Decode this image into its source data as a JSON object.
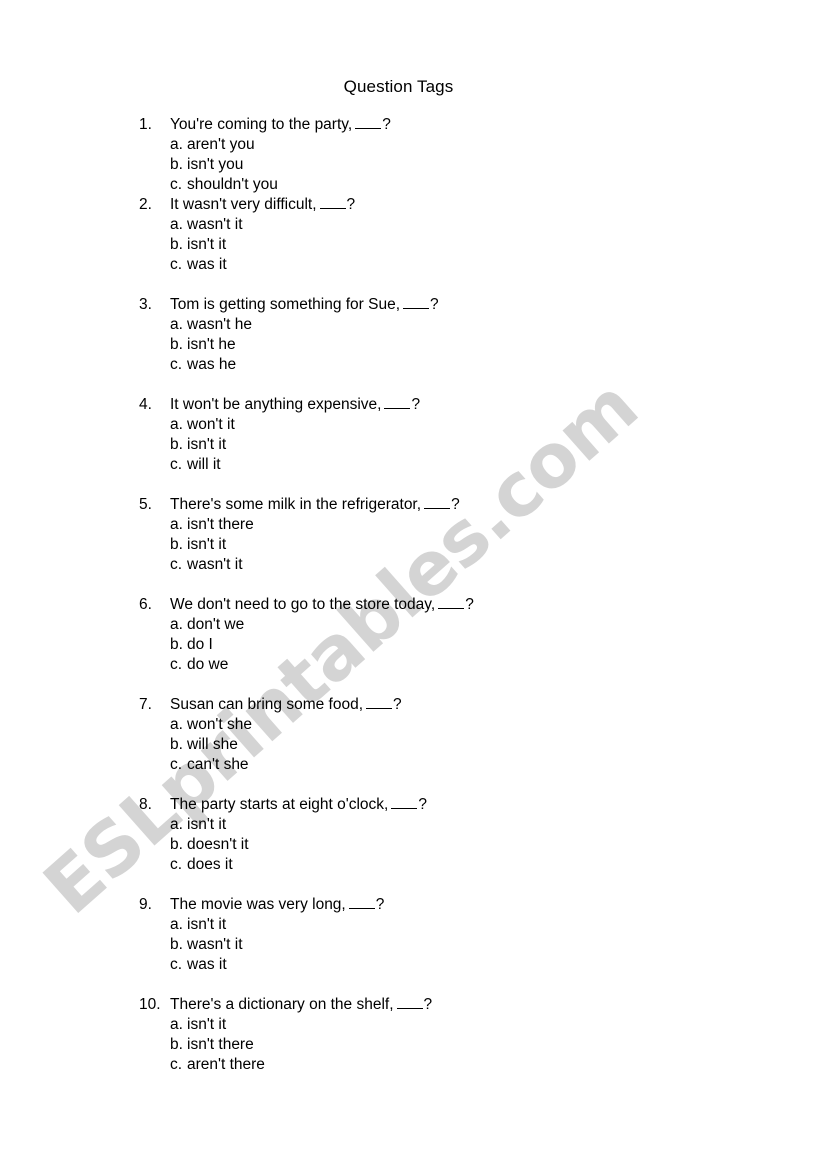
{
  "document": {
    "title": "Question Tags",
    "watermark": "ESLprintables.com",
    "watermark_color": "#d4d4d4",
    "text_color": "#000000",
    "background_color": "#ffffff",
    "blank_placeholder": "___",
    "question_mark": "?"
  },
  "questions": [
    {
      "number": "1.",
      "text": "You're coming to the party, ",
      "tail": "?",
      "spaced_above": false,
      "options": [
        {
          "letter": "a.",
          "text": "aren't you"
        },
        {
          "letter": "b.",
          "text": "isn't you"
        },
        {
          "letter": "c.",
          "text": "shouldn't you"
        }
      ]
    },
    {
      "number": "2.",
      "text": "It wasn't very difficult, ",
      "tail": "?",
      "spaced_above": false,
      "options": [
        {
          "letter": "a.",
          "text": "wasn't it"
        },
        {
          "letter": "b.",
          "text": "isn't it"
        },
        {
          "letter": "c.",
          "text": "was it"
        }
      ]
    },
    {
      "number": "3.",
      "text": "Tom is getting something for Sue, ",
      "tail": "?",
      "spaced_above": true,
      "options": [
        {
          "letter": "a.",
          "text": "wasn't he"
        },
        {
          "letter": "b.",
          "text": "isn't he"
        },
        {
          "letter": "c.",
          "text": "was he"
        }
      ]
    },
    {
      "number": "4.",
      "text": "It won't be anything expensive, ",
      "tail": "?",
      "spaced_above": true,
      "options": [
        {
          "letter": "a.",
          "text": "won't it"
        },
        {
          "letter": "b.",
          "text": "isn't it"
        },
        {
          "letter": "c.",
          "text": "will it"
        }
      ]
    },
    {
      "number": "5.",
      "text": "There's some milk in the refrigerator, ",
      "tail": "?",
      "spaced_above": true,
      "options": [
        {
          "letter": "a.",
          "text": "isn't there"
        },
        {
          "letter": "b.",
          "text": "isn't it"
        },
        {
          "letter": "c.",
          "text": "wasn't it"
        }
      ]
    },
    {
      "number": "6.",
      "text": "We don't need to go to the store today, ",
      "tail": "?",
      "spaced_above": true,
      "options": [
        {
          "letter": "a.",
          "text": "don't we"
        },
        {
          "letter": "b.",
          "text": "do I"
        },
        {
          "letter": "c.",
          "text": "do we"
        }
      ]
    },
    {
      "number": "7.",
      "text": "Susan can bring some food, ",
      "tail": "?",
      "spaced_above": true,
      "options": [
        {
          "letter": "a.",
          "text": "won't she"
        },
        {
          "letter": "b.",
          "text": "will she"
        },
        {
          "letter": "c.",
          "text": "can't she"
        }
      ]
    },
    {
      "number": "8.",
      "text": "The party starts at eight o'clock, ",
      "tail": "?",
      "spaced_above": true,
      "options": [
        {
          "letter": "a.",
          "text": "isn't it"
        },
        {
          "letter": "b.",
          "text": "doesn't it"
        },
        {
          "letter": "c.",
          "text": "does it"
        }
      ]
    },
    {
      "number": "9.",
      "text": "The movie was very long, ",
      "tail": "?",
      "spaced_above": true,
      "options": [
        {
          "letter": "a.",
          "text": "isn't it"
        },
        {
          "letter": "b.",
          "text": "wasn't it"
        },
        {
          "letter": "c.",
          "text": "was it"
        }
      ]
    },
    {
      "number": "10.",
      "text": "There's a dictionary on the shelf, ",
      "tail": "?",
      "spaced_above": true,
      "options": [
        {
          "letter": "a.",
          "text": "isn't it"
        },
        {
          "letter": "b.",
          "text": "isn't there"
        },
        {
          "letter": "c.",
          "text": "aren't there"
        }
      ]
    }
  ]
}
